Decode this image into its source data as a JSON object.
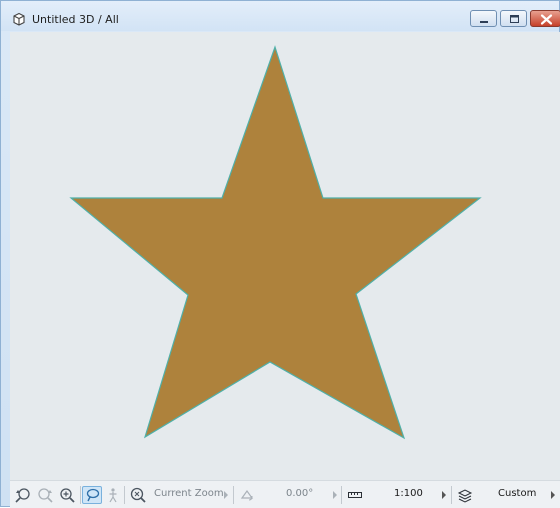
{
  "window": {
    "title": "Untitled 3D / All",
    "icon": "3d-cube-icon",
    "controls": [
      "minimize-icon",
      "maximize-icon",
      "close-icon"
    ]
  },
  "viewport": {
    "shape": "star",
    "fill_color": "#ae823c",
    "outline_color": "#4fb0a8",
    "background_color": "#e5eaed"
  },
  "statusbar": {
    "zoom_tools": [
      "undo-zoom-icon",
      "redo-zoom-icon",
      "zoom-in-icon",
      "pan-icon",
      "walk-icon"
    ],
    "zoom_label": "Current Zoom",
    "rotation_value": "0.00°",
    "scale_value": "1:100",
    "layer_combo": "Custom"
  }
}
